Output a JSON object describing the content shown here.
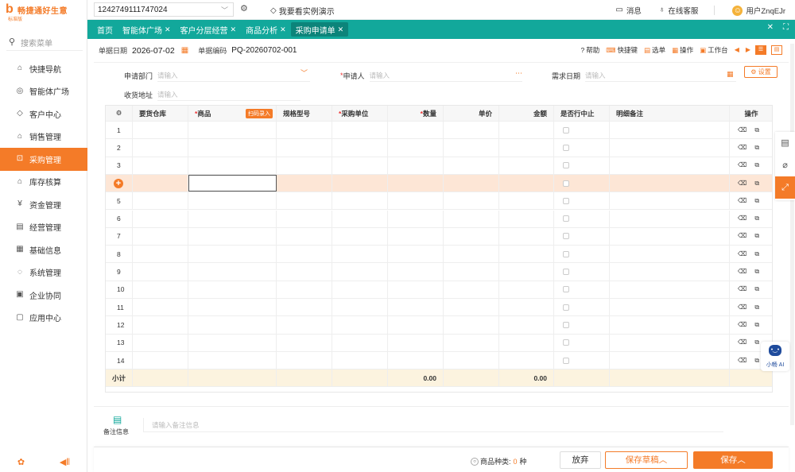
{
  "brand": {
    "name": "畅捷通好生意",
    "edition": "标准版",
    "logo_glyph": "b"
  },
  "sidebar": {
    "search_placeholder": "搜索菜单",
    "items": [
      {
        "label": "快捷导航",
        "icon": "⌂"
      },
      {
        "label": "智能体广场",
        "icon": "◎"
      },
      {
        "label": "客户中心",
        "icon": "◇"
      },
      {
        "label": "销售管理",
        "icon": "⌂"
      },
      {
        "label": "采购管理",
        "icon": "⊡"
      },
      {
        "label": "库存核算",
        "icon": "⌂"
      },
      {
        "label": "资金管理",
        "icon": "¥"
      },
      {
        "label": "经营管理",
        "icon": "▤"
      },
      {
        "label": "基础信息",
        "icon": "▦"
      },
      {
        "label": "系统管理",
        "icon": "◌"
      },
      {
        "label": "企业协同",
        "icon": "▣"
      },
      {
        "label": "应用中心",
        "icon": "▢"
      }
    ],
    "active_index": 4
  },
  "topbar": {
    "account": "1242749111747024",
    "demo_label": "我要看实例演示",
    "messages_label": "消息",
    "service_label": "在线客服",
    "user_label": "用户ZnqEJr"
  },
  "tabs": [
    {
      "label": "首页",
      "closable": false,
      "active": false
    },
    {
      "label": "智能体广场",
      "closable": true,
      "active": false
    },
    {
      "label": "客户分层经营",
      "closable": true,
      "active": false
    },
    {
      "label": "商品分析",
      "closable": true,
      "active": false
    },
    {
      "label": "采购申请单",
      "closable": true,
      "active": true
    }
  ],
  "docbar": {
    "date_label": "单据日期",
    "date_value": "2026-07-02",
    "code_label": "单据编码",
    "code_value": "PQ-20260702-001",
    "tools": {
      "help": "帮助",
      "shortcut": "快捷键",
      "select": "选单",
      "operate": "操作",
      "workbench": "工作台"
    }
  },
  "form": {
    "dept_label": "申请部门",
    "dept_placeholder": "请输入",
    "applicant_label": "申请人",
    "applicant_placeholder": "请输入",
    "demand_date_label": "需求日期",
    "demand_date_placeholder": "请输入",
    "address_label": "收货地址",
    "address_placeholder": "请输入",
    "settings_label": "设置"
  },
  "grid": {
    "columns": [
      {
        "label": "要货仓库",
        "required": false
      },
      {
        "label": "商品",
        "required": true
      },
      {
        "label": "规格型号",
        "required": false
      },
      {
        "label": "采购单位",
        "required": true
      },
      {
        "label": "数量",
        "required": true
      },
      {
        "label": "单价",
        "required": false
      },
      {
        "label": "金额",
        "required": false
      },
      {
        "label": "是否行中止",
        "required": false
      },
      {
        "label": "明细备注",
        "required": false
      },
      {
        "label": "操作",
        "required": false
      }
    ],
    "scan_label": "扫码录入",
    "row_numbers": [
      "1",
      "2",
      "3",
      "",
      "5",
      "6",
      "7",
      "8",
      "9",
      "10",
      "11",
      "12",
      "13",
      "14"
    ],
    "highlight_row_index": 3,
    "subtotal_label": "小计",
    "subtotal_qty": "0.00",
    "subtotal_amount": "0.00"
  },
  "remarks": {
    "label": "备注信息",
    "placeholder": "请输入备注信息"
  },
  "footer": {
    "kinds_label": "商品种类:",
    "kinds_value": "0",
    "kinds_unit": "种",
    "discard": "放弃",
    "save_draft": "保存草稿",
    "save": "保存"
  },
  "robot": {
    "label": "小畅 AI"
  },
  "colors": {
    "accent": "#f47b28",
    "tabbar": "#12a89b",
    "highlight_row": "#fde6d6",
    "subtotal_row": "#fcf3df"
  }
}
